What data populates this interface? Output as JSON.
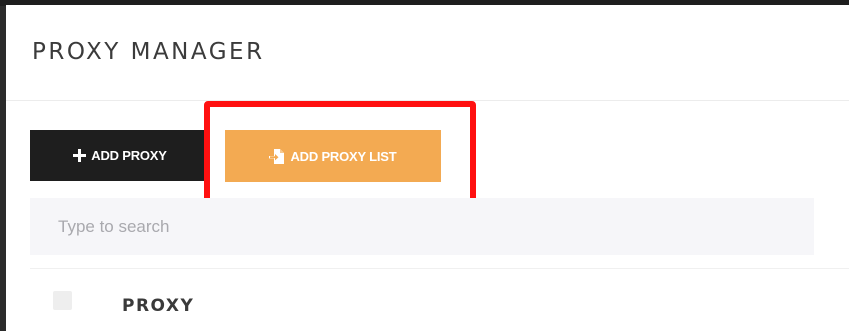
{
  "header": {
    "title": "PROXY MANAGER"
  },
  "toolbar": {
    "add_proxy_label": "ADD PROXY",
    "add_proxy_icon": "plus-icon",
    "add_proxy_list_label": "ADD PROXY LIST",
    "add_proxy_list_icon": "file-import-icon"
  },
  "search": {
    "placeholder": "Type to search",
    "value": ""
  },
  "table": {
    "columns": [
      "PROXY"
    ]
  },
  "colors": {
    "add_proxy_bg": "#1e1e1e",
    "add_proxy_list_bg": "#f3aa52",
    "highlight": "#ff1010"
  }
}
